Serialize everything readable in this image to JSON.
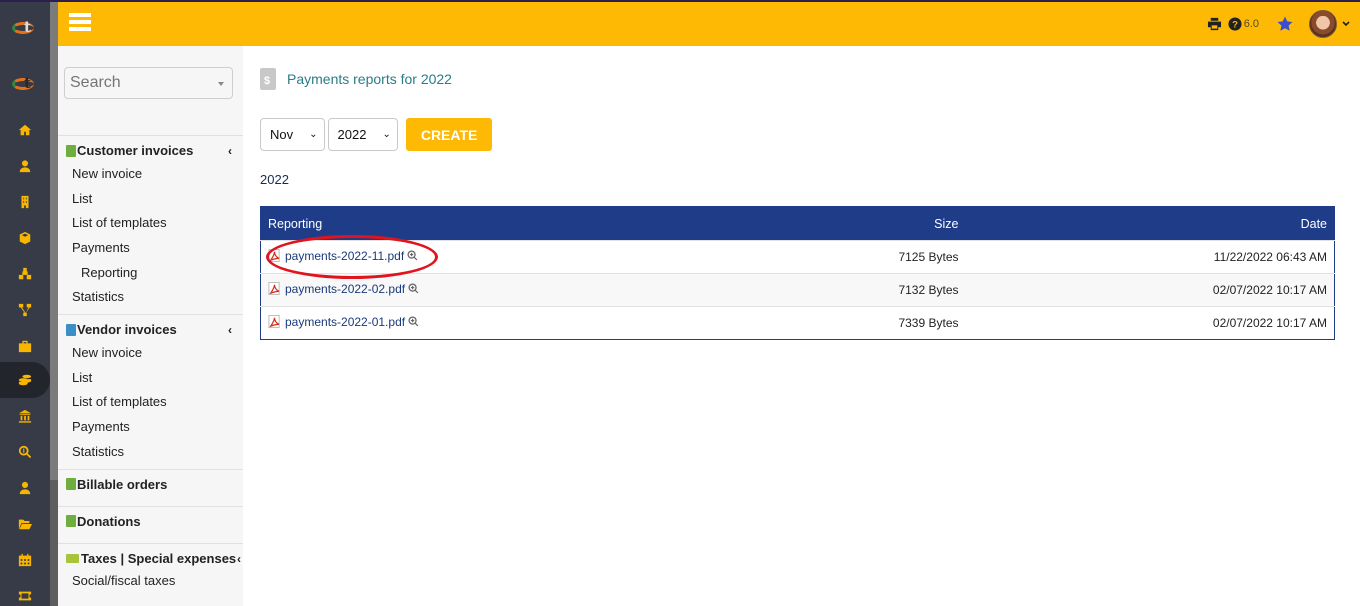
{
  "topbar": {
    "version": "6.0",
    "icons": [
      "menu-icon",
      "print-icon",
      "help-icon",
      "star-icon",
      "user-avatar",
      "chevron-down-icon"
    ]
  },
  "rail": {
    "icons": [
      "home-icon",
      "user-icon",
      "building-icon",
      "box-icon",
      "boxes-icon",
      "flow-icon",
      "briefcase-icon",
      "coins-icon",
      "bank-icon",
      "search-dollar-icon",
      "user-tie-icon",
      "folder-open-icon",
      "calendar-icon",
      "ticket-icon"
    ],
    "active": "coins-icon"
  },
  "sidebar": {
    "search_placeholder": "Search",
    "groups": [
      {
        "title": "Customer invoices",
        "icon_color": "#6fae3e",
        "collapsible": true,
        "items": [
          {
            "label": "New invoice"
          },
          {
            "label": "List"
          },
          {
            "label": "List of templates"
          },
          {
            "label": "Payments"
          },
          {
            "label": "Reporting",
            "sub": true
          },
          {
            "label": "Statistics"
          }
        ]
      },
      {
        "title": "Vendor invoices",
        "icon_color": "#3b8fc4",
        "collapsible": true,
        "items": [
          {
            "label": "New invoice"
          },
          {
            "label": "List"
          },
          {
            "label": "List of templates"
          },
          {
            "label": "Payments"
          },
          {
            "label": "Statistics"
          }
        ]
      },
      {
        "title": "Billable orders",
        "icon_color": "#6fae3e",
        "collapsible": false,
        "items": []
      },
      {
        "title": "Donations",
        "icon_color": "#6fae3e",
        "collapsible": false,
        "items": []
      },
      {
        "title": "Taxes | Special expenses",
        "icon_color": "#a7c43b",
        "collapsible": true,
        "items": [
          {
            "label": "Social/fiscal taxes"
          }
        ]
      }
    ]
  },
  "main": {
    "title": "Payments reports for 2022",
    "month_select": "Nov",
    "year_select": "2022",
    "create_label": "CREATE",
    "year_heading": "2022",
    "table": {
      "headers": {
        "file": "Reporting",
        "size": "Size",
        "date": "Date"
      },
      "rows": [
        {
          "file": "payments-2022-11.pdf",
          "size": "7125 Bytes",
          "date": "11/22/2022 06:43 AM",
          "highlighted": true
        },
        {
          "file": "payments-2022-02.pdf",
          "size": "7132 Bytes",
          "date": "02/07/2022 10:17 AM"
        },
        {
          "file": "payments-2022-01.pdf",
          "size": "7339 Bytes",
          "date": "02/07/2022 10:17 AM"
        }
      ]
    }
  },
  "colors": {
    "accent": "#fdb904",
    "table_header": "#1f3c88",
    "rail": "#363b47",
    "highlight_circle": "#e0141e",
    "title_link": "#2a7c88"
  }
}
